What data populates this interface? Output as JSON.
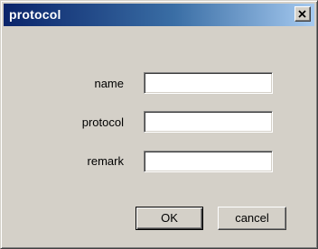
{
  "window": {
    "title": "protocol"
  },
  "icons": {
    "close": "close-icon"
  },
  "form": {
    "fields": [
      {
        "label": "name",
        "value": ""
      },
      {
        "label": "protocol",
        "value": ""
      },
      {
        "label": "remark",
        "value": ""
      }
    ]
  },
  "buttons": {
    "ok_label": "OK",
    "cancel_label": "cancel"
  },
  "colors": {
    "titlebar_start": "#0a246a",
    "titlebar_end": "#a6caf0",
    "face": "#d4d0c8"
  }
}
